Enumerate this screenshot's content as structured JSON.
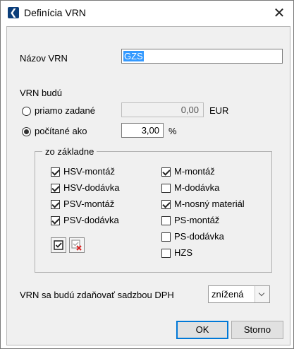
{
  "window": {
    "title": "Definícia VRN",
    "close_glyph": "✕"
  },
  "name": {
    "label": "Názov VRN",
    "value": "GZS"
  },
  "vrn_mode": {
    "heading": "VRN budú",
    "direct": {
      "label": "priamo zadané",
      "value": "0,00",
      "unit": "EUR",
      "selected": false
    },
    "computed": {
      "label": "počítané ako",
      "value": "3,00",
      "unit": "%",
      "selected": true
    }
  },
  "base": {
    "title": "zo základne",
    "left": [
      {
        "label": "HSV-montáž",
        "checked": true
      },
      {
        "label": "HSV-dodávka",
        "checked": true
      },
      {
        "label": "PSV-montáž",
        "checked": true
      },
      {
        "label": "PSV-dodávka",
        "checked": true
      }
    ],
    "right": [
      {
        "label": "M-montáž",
        "checked": true
      },
      {
        "label": "M-dodávka",
        "checked": false
      },
      {
        "label": "M-nosný materiál",
        "checked": true
      },
      {
        "label": "PS-montáž",
        "checked": false
      },
      {
        "label": "PS-dodávka",
        "checked": false
      },
      {
        "label": "HZS",
        "checked": false
      }
    ],
    "icons": [
      "check-all-icon",
      "uncheck-all-icon"
    ]
  },
  "vat": {
    "label": "VRN sa budú zdaňovať sadzbou DPH",
    "selected": "znížená"
  },
  "buttons": {
    "ok": "OK",
    "cancel": "Storno"
  }
}
